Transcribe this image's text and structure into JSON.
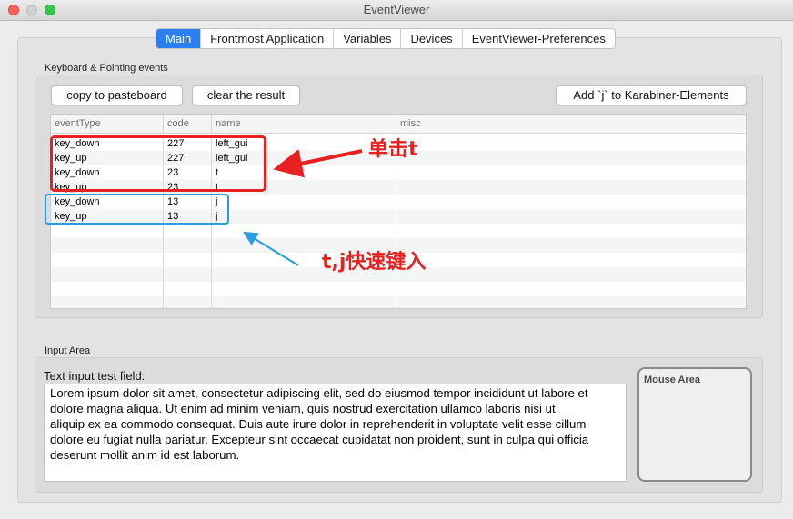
{
  "window": {
    "title": "EventViewer"
  },
  "tabs": [
    {
      "label": "Main",
      "active": true
    },
    {
      "label": "Frontmost Application",
      "active": false
    },
    {
      "label": "Variables",
      "active": false
    },
    {
      "label": "Devices",
      "active": false
    },
    {
      "label": "EventViewer-Preferences",
      "active": false
    }
  ],
  "events_group": {
    "label": "Keyboard & Pointing events",
    "copy_button": "copy to pasteboard",
    "clear_button": "clear the result",
    "add_button": "Add `j` to Karabiner-Elements"
  },
  "table": {
    "columns": [
      "eventType",
      "code",
      "name",
      "misc"
    ],
    "rows": [
      {
        "type": "key_down",
        "code": "227",
        "name": "left_gui",
        "misc": ""
      },
      {
        "type": "key_up",
        "code": "227",
        "name": "left_gui",
        "misc": ""
      },
      {
        "type": "key_down",
        "code": "23",
        "name": "t",
        "misc": ""
      },
      {
        "type": "key_up",
        "code": "23",
        "name": "t",
        "misc": ""
      },
      {
        "type": "key_down",
        "code": "13",
        "name": "j",
        "misc": ""
      },
      {
        "type": "key_up",
        "code": "13",
        "name": "j",
        "misc": ""
      }
    ],
    "empty_rows": 6
  },
  "annotations": {
    "red": "单击t",
    "blue": "t,j快速键入",
    "red_color": "#e8201f",
    "blue_color": "#2a9be0"
  },
  "input_group": {
    "label": "Input Area",
    "text_field_label": "Text input test field:",
    "text_lines": [
      "Lorem ipsum dolor sit amet, consectetur adipiscing elit, sed do eiusmod tempor incididunt ut labore et",
      "dolore magna aliqua. Ut enim ad minim veniam, quis nostrud exercitation ullamco laboris nisi ut",
      "aliquip ex ea commodo consequat. Duis aute irure dolor in reprehenderit in voluptate velit esse cillum",
      "dolore eu fugiat nulla pariatur. Excepteur sint occaecat cupidatat non proident, sunt in culpa qui officia",
      "deserunt mollit anim id est laborum."
    ],
    "mouse_area_label": "Mouse Area"
  }
}
